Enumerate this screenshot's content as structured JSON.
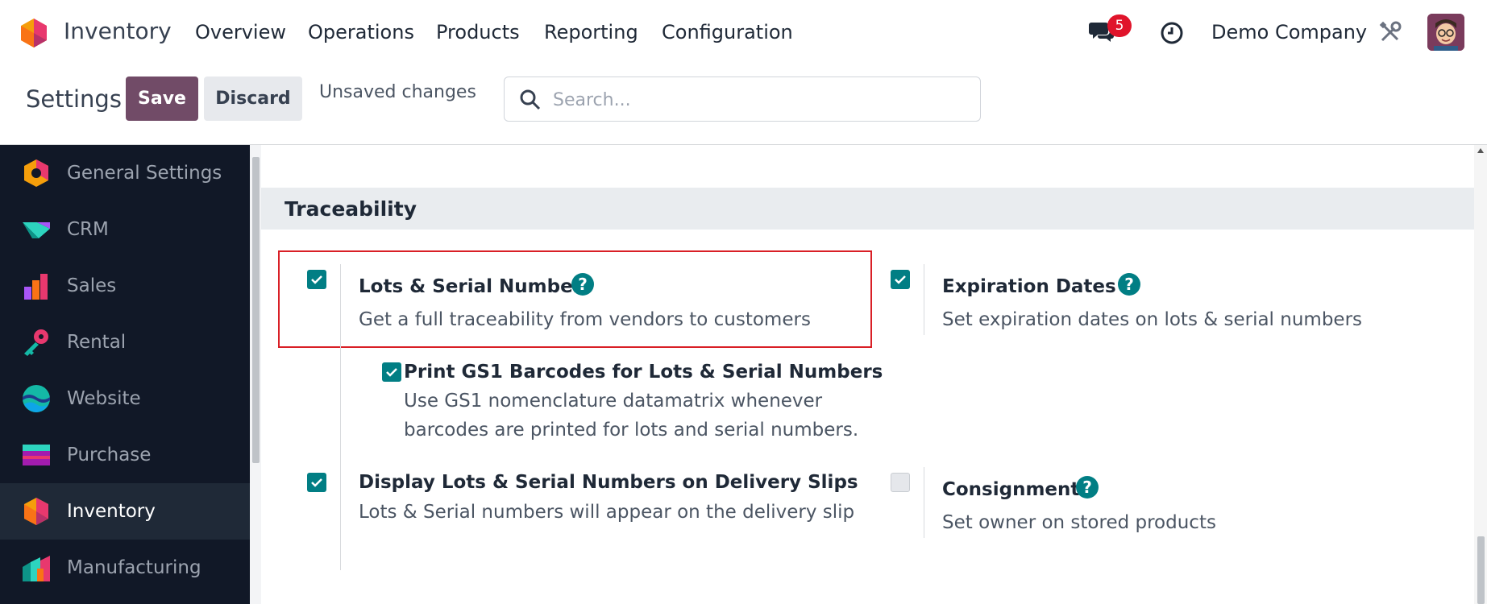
{
  "topbar": {
    "app_name": "Inventory",
    "menu": [
      "Overview",
      "Operations",
      "Products",
      "Reporting",
      "Configuration"
    ],
    "chat_badge": "5",
    "company": "Demo Company"
  },
  "control_panel": {
    "title": "Settings",
    "save_label": "Save",
    "discard_label": "Discard",
    "status": "Unsaved changes",
    "search_placeholder": "Search..."
  },
  "sidebar": {
    "items": [
      {
        "label": "General Settings",
        "icon": "general-settings-icon",
        "active": false
      },
      {
        "label": "CRM",
        "icon": "crm-icon",
        "active": false
      },
      {
        "label": "Sales",
        "icon": "sales-icon",
        "active": false
      },
      {
        "label": "Rental",
        "icon": "rental-icon",
        "active": false
      },
      {
        "label": "Website",
        "icon": "website-icon",
        "active": false
      },
      {
        "label": "Purchase",
        "icon": "purchase-icon",
        "active": false
      },
      {
        "label": "Inventory",
        "icon": "inventory-icon",
        "active": true
      },
      {
        "label": "Manufacturing",
        "icon": "manufacturing-icon",
        "active": false
      }
    ]
  },
  "section": {
    "title": "Traceability",
    "settings": {
      "lots_serial": {
        "title": "Lots & Serial Numbers",
        "desc": "Get a full traceability from vendors to customers",
        "checked": true
      },
      "gs1": {
        "title": "Print GS1 Barcodes for Lots & Serial Numbers",
        "desc_line1": "Use GS1 nomenclature datamatrix whenever",
        "desc_line2": "barcodes are printed for lots and serial numbers.",
        "checked": true
      },
      "delivery_slips": {
        "title": "Display Lots & Serial Numbers on Delivery Slips",
        "desc": "Lots & Serial numbers will appear on the delivery slip",
        "checked": true
      },
      "expiration": {
        "title": "Expiration Dates",
        "desc": "Set expiration dates on lots & serial numbers",
        "checked": true
      },
      "consignment": {
        "title": "Consignment",
        "desc": "Set owner on stored products",
        "checked": false
      }
    }
  },
  "colors": {
    "brand": "#714b67",
    "checkbox": "#017e84",
    "highlight": "#d91f26",
    "sidebar_bg": "#111827"
  }
}
